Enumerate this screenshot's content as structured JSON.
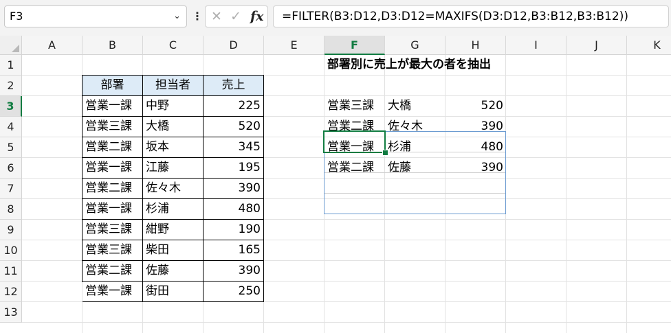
{
  "name_box": {
    "value": "F3",
    "chevron": "chevron-down-icon"
  },
  "formula_bar": {
    "more_icon": "⋮",
    "cancel_icon": "✕",
    "enter_icon": "✓",
    "fx_label": "fx",
    "formula": "=FILTER(B3:D12,D3:D12=MAXIFS(D3:D12,B3:B12,B3:B12))"
  },
  "columns": [
    "A",
    "B",
    "C",
    "D",
    "E",
    "F",
    "G",
    "H",
    "I",
    "J",
    "K"
  ],
  "rows": [
    "1",
    "2",
    "3",
    "4",
    "5",
    "6",
    "7",
    "8",
    "9",
    "10",
    "11",
    "12",
    "13"
  ],
  "selected_column": "F",
  "selected_row": "3",
  "source_table": {
    "headers": [
      "部署",
      "担当者",
      "売上"
    ],
    "rows": [
      [
        "営業一課",
        "中野",
        "225"
      ],
      [
        "営業三課",
        "大橋",
        "520"
      ],
      [
        "営業二課",
        "坂本",
        "345"
      ],
      [
        "営業一課",
        "江藤",
        "195"
      ],
      [
        "営業二課",
        "佐々木",
        "390"
      ],
      [
        "営業一課",
        "杉浦",
        "480"
      ],
      [
        "営業三課",
        "紺野",
        "190"
      ],
      [
        "営業三課",
        "柴田",
        "165"
      ],
      [
        "営業二課",
        "佐藤",
        "390"
      ],
      [
        "営業一課",
        "街田",
        "250"
      ]
    ]
  },
  "result_title": "部署別に売上が最大の者を抽出",
  "result_table": {
    "rows": [
      [
        "営業三課",
        "大橋",
        "520"
      ],
      [
        "営業二課",
        "佐々木",
        "390"
      ],
      [
        "営業一課",
        "杉浦",
        "480"
      ],
      [
        "営業二課",
        "佐藤",
        "390"
      ]
    ]
  }
}
